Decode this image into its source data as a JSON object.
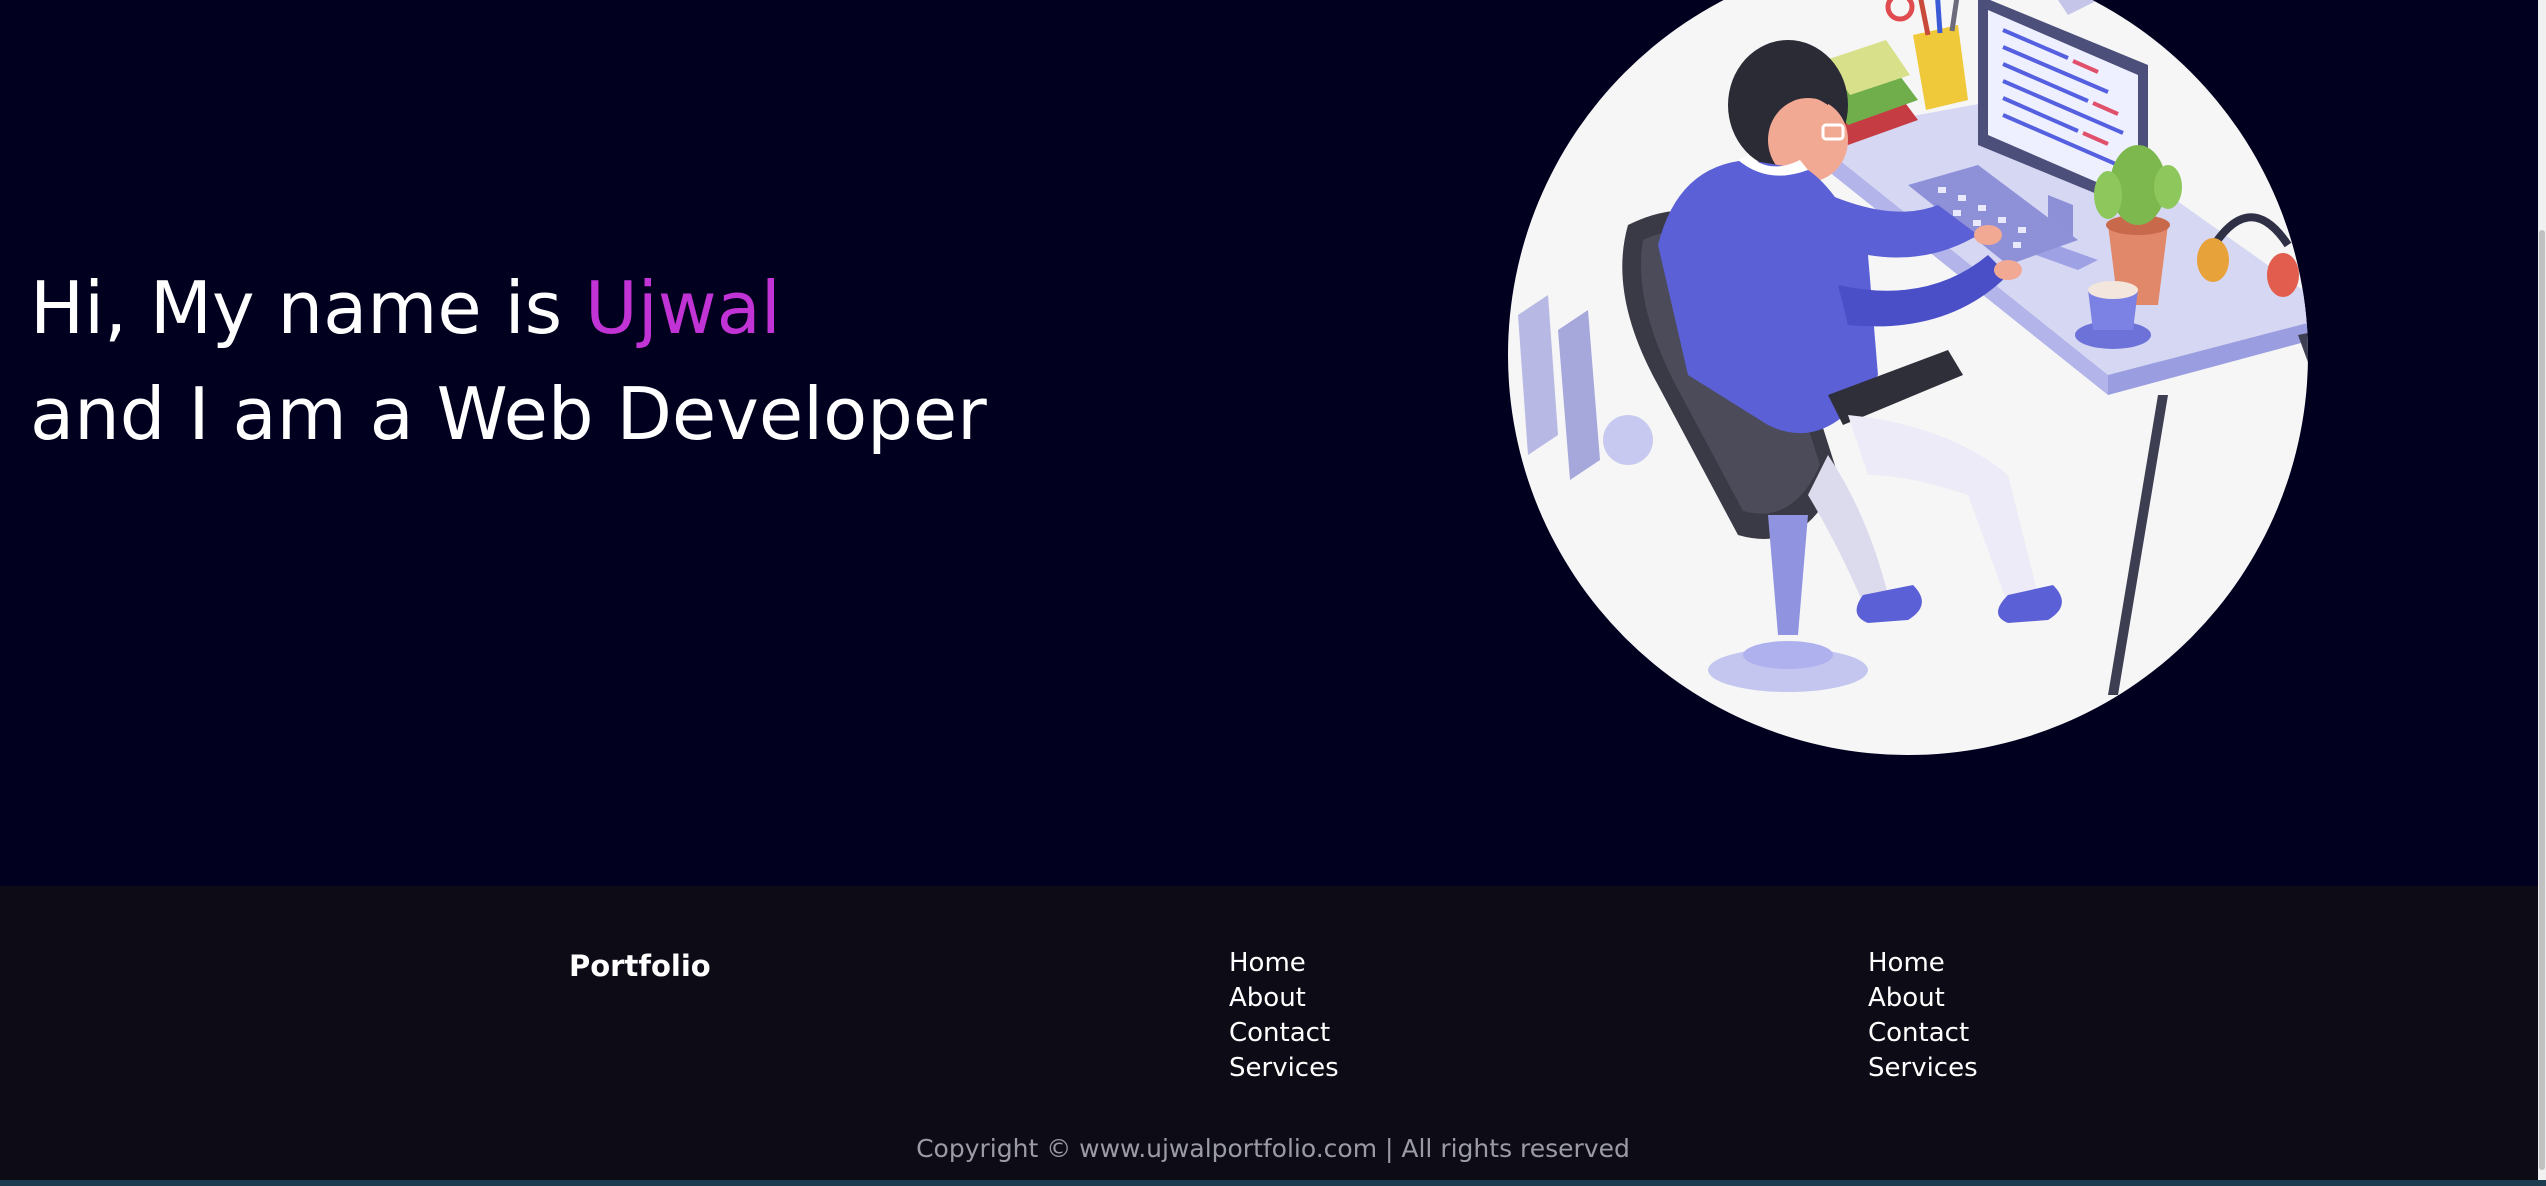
{
  "hero": {
    "greeting": "Hi, My name is ",
    "name": "Ujwal",
    "subtitle": "and I am a Web Developer"
  },
  "illustration": {
    "icon": "developer-at-desk-illustration"
  },
  "footer": {
    "brand": "Portfolio",
    "links_col1": [
      "Home",
      "About",
      "Contact",
      "Services"
    ],
    "links_col2": [
      "Home",
      "About",
      "Contact",
      "Services"
    ],
    "copyright": "Copyright © www.ujwalportfolio.com | All rights reserved"
  },
  "colors": {
    "background": "#02001f",
    "accent": "#c233d6",
    "footer_bg": "#0d0c16",
    "text": "#ffffff",
    "muted_text": "#9b9ba6"
  }
}
